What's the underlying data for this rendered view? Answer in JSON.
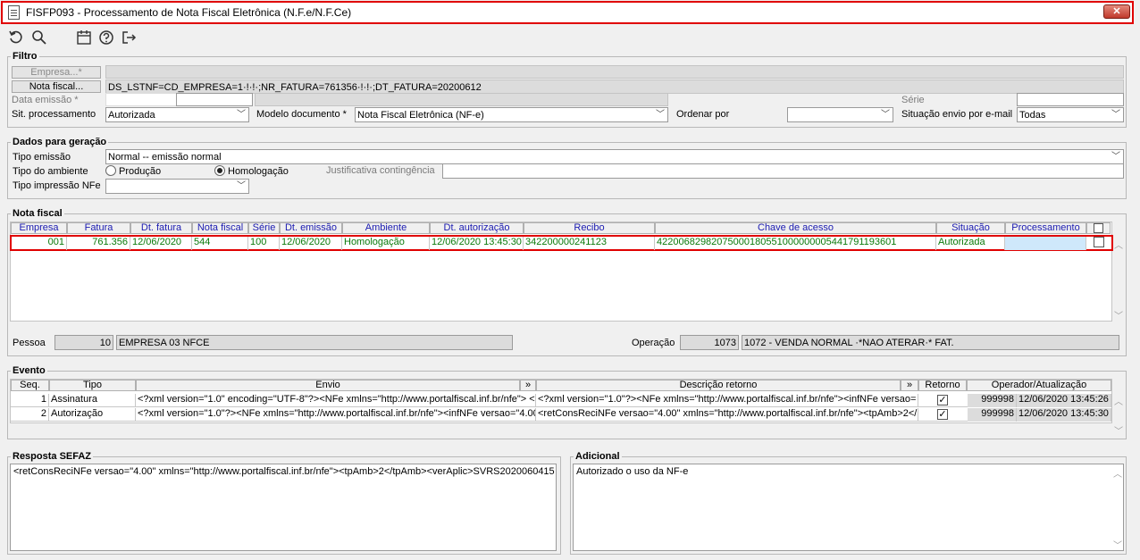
{
  "window": {
    "title": "FISFP093 - Processamento de Nota Fiscal Eletrônica (N.F.e/N.F.Ce)",
    "close_label": "✕"
  },
  "toolbar": {
    "icons": [
      "undo-icon",
      "search-icon",
      "calendar-icon",
      "help-icon",
      "exit-icon"
    ]
  },
  "filtro": {
    "title": "Filtro",
    "empresa_button": "Empresa...*",
    "nota_fiscal_button": "Nota fiscal...",
    "nota_fiscal_value": "DS_LSTNF=CD_EMPRESA=1·!·!·;NR_FATURA=761356·!·!·;DT_FATURA=20200612",
    "data_emissao_label": "Data emissão *",
    "serie_label": "Série",
    "sit_processamento_label": "Sit. processamento",
    "sit_processamento_value": "Autorizada",
    "modelo_documento_label": "Modelo documento *",
    "modelo_documento_value": "Nota Fiscal Eletrônica (NF-e)",
    "ordenar_por_label": "Ordenar por",
    "ordenar_por_value": "",
    "situacao_envio_label": "Situação envio por e-mail",
    "situacao_envio_value": "Todas"
  },
  "dados": {
    "title": "Dados para geração",
    "tipo_emissao_label": "Tipo emissão",
    "tipo_emissao_value": "Normal -- emissão normal",
    "tipo_ambiente_label": "Tipo do ambiente",
    "producao_label": "Produção",
    "homologacao_label": "Homologação",
    "justificativa_label": "Justificativa contingência",
    "tipo_impressao_label": "Tipo impressão NFe",
    "tipo_impressao_value": ""
  },
  "nota_fiscal": {
    "title": "Nota fiscal",
    "columns": [
      "Empresa",
      "Fatura",
      "Dt. fatura",
      "Nota fiscal",
      "Série",
      "Dt. emissão",
      "Ambiente",
      "Dt. autorização",
      "Recibo",
      "Chave de acesso",
      "Situação",
      "Processamento"
    ],
    "row": {
      "empresa": "001",
      "fatura": "761.356",
      "dt_fatura": "12/06/2020",
      "nota_fiscal": "544",
      "serie": "100",
      "dt_emissao": "12/06/2020",
      "ambiente": "Homologação",
      "dt_autorizacao": "12/06/2020 13:45:30",
      "recibo": "342200000241123",
      "chave": "42200682982075000180551000000005441791193601",
      "situacao": "Autorizada",
      "processamento": ""
    },
    "pessoa_label": "Pessoa",
    "pessoa_code": "10",
    "pessoa_name": "EMPRESA 03 NFCE",
    "operacao_label": "Operação",
    "operacao_code": "1073",
    "operacao_name": "1072 - VENDA NORMAL ·*NAO ATERAR·* FAT."
  },
  "evento": {
    "title": "Evento",
    "columns": [
      "Seq.",
      "Tipo",
      "Envio",
      "»",
      "Descrição retorno",
      "»",
      "Retorno",
      "Operador/Atualização"
    ],
    "rows": [
      {
        "seq": "1",
        "tipo": "Assinatura",
        "envio": "<?xml version=\"1.0\" encoding=\"UTF-8\"?><NFe xmlns=\"http://www.portalfiscal.inf.br/nfe\"> <i",
        "retorno_desc": "<?xml version=\"1.0\"?><NFe xmlns=\"http://www.portalfiscal.inf.br/nfe\"><infNFe versao=",
        "retorno": "✓",
        "operador": "999998",
        "atualizacao": "12/06/2020 13:45:26"
      },
      {
        "seq": "2",
        "tipo": "Autorização",
        "envio": "<?xml version=\"1.0\"?><NFe xmlns=\"http://www.portalfiscal.inf.br/nfe\"><infNFe versao=\"4.00",
        "retorno_desc": "<retConsReciNFe versao=\"4.00\" xmlns=\"http://www.portalfiscal.inf.br/nfe\"><tpAmb>2</",
        "retorno": "✓",
        "operador": "999998",
        "atualizacao": "12/06/2020 13:45:30"
      }
    ]
  },
  "resposta": {
    "title": "Resposta SEFAZ",
    "text": "<retConsReciNFe versao=\"4.00\" xmlns=\"http://www.portalfiscal.inf.br/nfe\"><tpAmb>2</tpAmb><verAplic>SVRS2020060415"
  },
  "adicional": {
    "title": "Adicional",
    "text": "Autorizado o uso da NF-e"
  }
}
